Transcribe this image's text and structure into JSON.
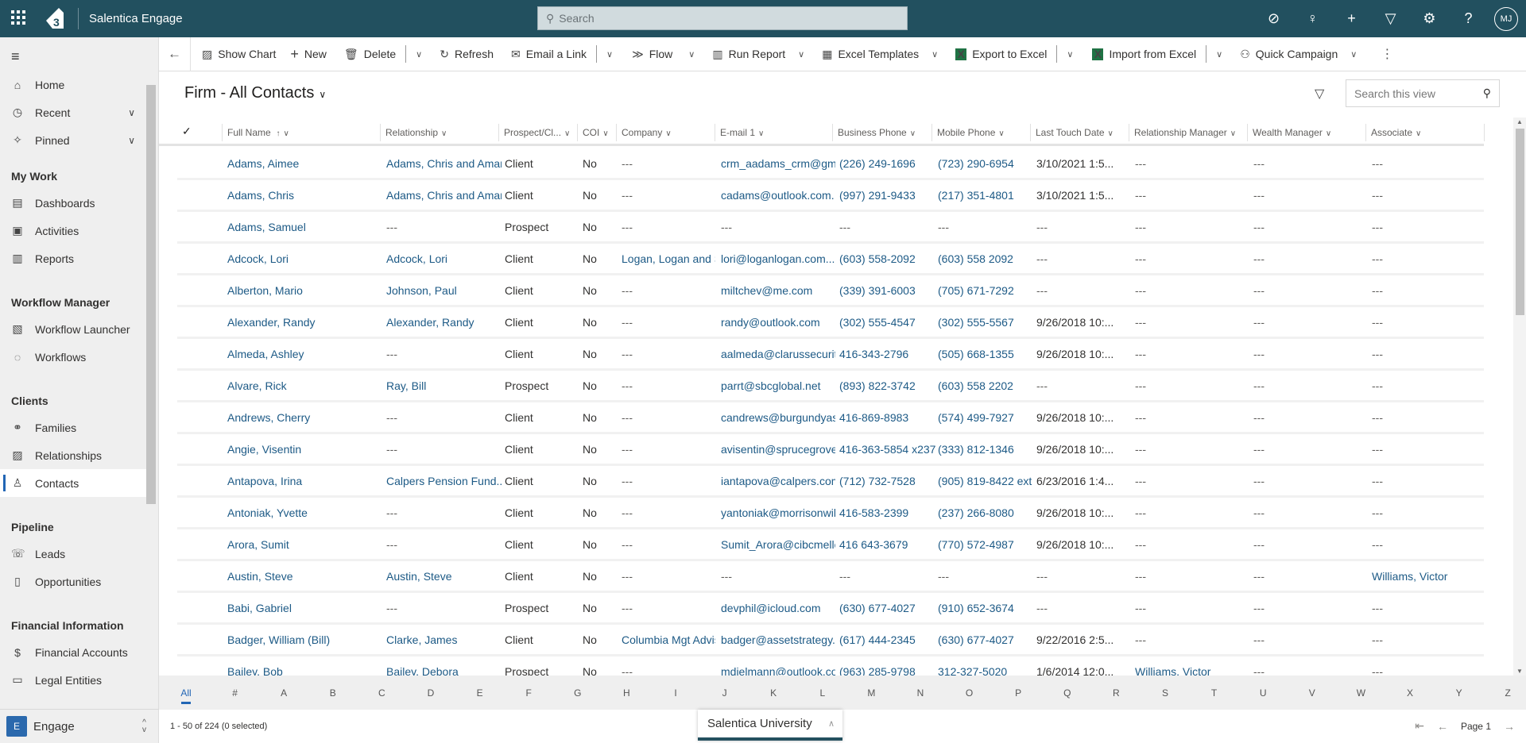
{
  "app": {
    "title": "Salentica Engage",
    "search_placeholder": "Search",
    "user_initials": "MJ",
    "logo_text": "E"
  },
  "sidebar": {
    "top_items": [
      {
        "label": "Home",
        "icon": "home-icon"
      },
      {
        "label": "Recent",
        "icon": "clock-icon"
      },
      {
        "label": "Pinned",
        "icon": "pin-icon"
      }
    ],
    "sections": [
      {
        "title": "My Work",
        "items": [
          {
            "label": "Dashboards"
          },
          {
            "label": "Activities"
          },
          {
            "label": "Reports"
          }
        ]
      },
      {
        "title": "Workflow Manager",
        "items": [
          {
            "label": "Workflow Launcher"
          },
          {
            "label": "Workflows"
          }
        ]
      },
      {
        "title": "Clients",
        "items": [
          {
            "label": "Families"
          },
          {
            "label": "Relationships"
          },
          {
            "label": "Contacts",
            "selected": true
          }
        ]
      },
      {
        "title": "Pipeline",
        "items": [
          {
            "label": "Leads"
          },
          {
            "label": "Opportunities"
          }
        ]
      },
      {
        "title": "Financial Information",
        "items": [
          {
            "label": "Financial Accounts"
          },
          {
            "label": "Legal Entities"
          }
        ]
      }
    ],
    "area": {
      "badge": "E",
      "label": "Engage"
    }
  },
  "toolbar": {
    "show_chart": "Show Chart",
    "new": "New",
    "delete": "Delete",
    "refresh": "Refresh",
    "email_link": "Email a Link",
    "flow": "Flow",
    "run_report": "Run Report",
    "excel_templates": "Excel Templates",
    "export_excel": "Export to Excel",
    "import_excel": "Import from Excel",
    "quick_campaign": "Quick Campaign"
  },
  "view": {
    "title": "Firm - All Contacts",
    "search_placeholder": "Search this view"
  },
  "columns": [
    "Full Name",
    "Relationship",
    "Prospect/Cl...",
    "COI",
    "Company",
    "E-mail 1",
    "Business Phone",
    "Mobile Phone",
    "Last Touch Date",
    "Relationship Manager",
    "Wealth Manager",
    "Associate"
  ],
  "rows": [
    [
      "Adams, Aimee",
      "Adams, Chris and Amanda",
      "Client",
      "No",
      "---",
      "crm_aadams_crm@gmail.com",
      "(226) 249-1696",
      "(723) 290-6954",
      "3/10/2021 1:5...",
      "---",
      "---",
      "---"
    ],
    [
      "Adams, Chris",
      "Adams, Chris and Amanda",
      "Client",
      "No",
      "---",
      "cadams@outlook.com.",
      "(997) 291-9433",
      "(217) 351-4801",
      "3/10/2021 1:5...",
      "---",
      "---",
      "---"
    ],
    [
      "Adams, Samuel",
      "---",
      "Prospect",
      "No",
      "---",
      "---",
      "---",
      "---",
      "---",
      "---",
      "---",
      "---"
    ],
    [
      "Adcock, Lori",
      "Adcock, Lori",
      "Client",
      "No",
      "Logan, Logan and Smith",
      "lori@loganlogan.com...",
      "(603) 558-2092",
      "(603) 558 2092",
      "---",
      "---",
      "---",
      "---"
    ],
    [
      "Alberton, Mario",
      "Johnson, Paul",
      "Client",
      "No",
      "---",
      "miltchev@me.com",
      "(339) 391-6003",
      "(705) 671-7292",
      "---",
      "---",
      "---",
      "---"
    ],
    [
      "Alexander, Randy",
      "Alexander, Randy",
      "Client",
      "No",
      "---",
      "randy@outlook.com",
      "(302) 555-4547",
      "(302) 555-5567",
      "9/26/2018 10:...",
      "---",
      "---",
      "---"
    ],
    [
      "Almeda, Ashley",
      "---",
      "Client",
      "No",
      "---",
      "aalmeda@clarussecurities.com",
      "416-343-2796",
      "(505) 668-1355",
      "9/26/2018 10:...",
      "---",
      "---",
      "---"
    ],
    [
      "Alvare, Rick",
      "Ray, Bill",
      "Prospect",
      "No",
      "---",
      "parrt@sbcglobal.net",
      "(893) 822-3742",
      "(603) 558 2202",
      "---",
      "---",
      "---",
      "---"
    ],
    [
      "Andrews, Cherry",
      "---",
      "Client",
      "No",
      "---",
      "candrews@burgundyasset.com",
      "416-869-8983",
      "(574) 499-7927",
      "9/26/2018 10:...",
      "---",
      "---",
      "---"
    ],
    [
      "Angie, Visentin",
      "---",
      "Client",
      "No",
      "---",
      "avisentin@sprucegrove.com",
      "416-363-5854 x237",
      "(333) 812-1346",
      "9/26/2018 10:...",
      "---",
      "---",
      "---"
    ],
    [
      "Antapova, Irina",
      "Calpers Pension Fund...",
      "Client",
      "No",
      "---",
      "iantapova@calpers.com",
      "(712) 732-7528",
      "(905) 819-8422 ext",
      "6/23/2016 1:4...",
      "---",
      "---",
      "---"
    ],
    [
      "Antoniak, Yvette",
      "---",
      "Client",
      "No",
      "---",
      "yantoniak@morrisonwilliams.com",
      "416-583-2399",
      "(237) 266-8080",
      "9/26/2018 10:...",
      "---",
      "---",
      "---"
    ],
    [
      "Arora, Sumit",
      "---",
      "Client",
      "No",
      "---",
      "Sumit_Arora@cibcmellon.com",
      "416 643-3679",
      "(770) 572-4987",
      "9/26/2018 10:...",
      "---",
      "---",
      "---"
    ],
    [
      "Austin, Steve",
      "Austin, Steve",
      "Client",
      "No",
      "---",
      "---",
      "---",
      "---",
      "---",
      "---",
      "---",
      "Williams, Victor"
    ],
    [
      "Babi, Gabriel",
      "---",
      "Prospect",
      "No",
      "---",
      "devphil@icloud.com",
      "(630) 677-4027",
      "(910) 652-3674",
      "---",
      "---",
      "---",
      "---"
    ],
    [
      "Badger, William (Bill)",
      "Clarke, James",
      "Client",
      "No",
      "Columbia Mgt Advisors",
      "badger@assetstrategy.com",
      "(617) 444-2345",
      "(630) 677-4027",
      "9/22/2016 2:5...",
      "---",
      "---",
      "---"
    ],
    [
      "Bailey, Bob",
      "Bailey, Debora",
      "Prospect",
      "No",
      "---",
      "mdielmann@outlook.com",
      "(963) 285-9798",
      "312-327-5020",
      "1/6/2014 12:0...",
      "Williams, Victor",
      "---",
      "---"
    ]
  ],
  "alphabet": [
    "All",
    "#",
    "A",
    "B",
    "C",
    "D",
    "E",
    "F",
    "G",
    "H",
    "I",
    "J",
    "K",
    "L",
    "M",
    "N",
    "O",
    "P",
    "Q",
    "R",
    "S",
    "T",
    "U",
    "V",
    "W",
    "X",
    "Y",
    "Z"
  ],
  "footer": {
    "count": "1 - 50 of 224 (0 selected)",
    "university": "Salentica University",
    "page": "Page 1"
  },
  "colors": {
    "topbar": "#22505f",
    "link": "#1d5a86",
    "accent": "#2266b5"
  }
}
